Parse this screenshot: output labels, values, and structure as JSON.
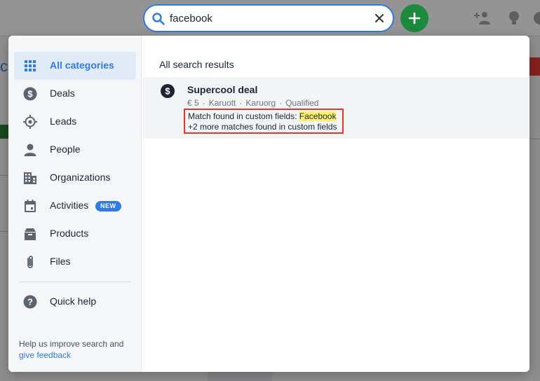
{
  "search": {
    "value": "facebook"
  },
  "colors": {
    "accent": "#317ae2",
    "add_button": "#1b8a3c",
    "highlight": "#fff36d",
    "match_border": "#d83a2c"
  },
  "sidebar": {
    "items": [
      {
        "label": "All categories",
        "icon": "grid-icon",
        "active": true
      },
      {
        "label": "Deals",
        "icon": "dollar-circle-icon"
      },
      {
        "label": "Leads",
        "icon": "target-icon"
      },
      {
        "label": "People",
        "icon": "person-icon"
      },
      {
        "label": "Organizations",
        "icon": "building-icon"
      },
      {
        "label": "Activities",
        "icon": "calendar-icon",
        "badge": "NEW"
      },
      {
        "label": "Products",
        "icon": "box-icon"
      },
      {
        "label": "Files",
        "icon": "paperclip-icon"
      }
    ],
    "quick_help": "Quick help",
    "help_text": "Help us improve search and",
    "feedback_link": "give feedback"
  },
  "results": {
    "title": "All search results",
    "items": [
      {
        "title": "Supercool deal",
        "icon": "dollar-circle-icon",
        "meta": [
          "€ 5",
          "Karuott",
          "Karuorg",
          "Qualified"
        ],
        "match_prefix": "Match found in custom fields: ",
        "match_term": "Facebook",
        "more_matches": "+2 more matches found in custom fields"
      }
    ]
  }
}
